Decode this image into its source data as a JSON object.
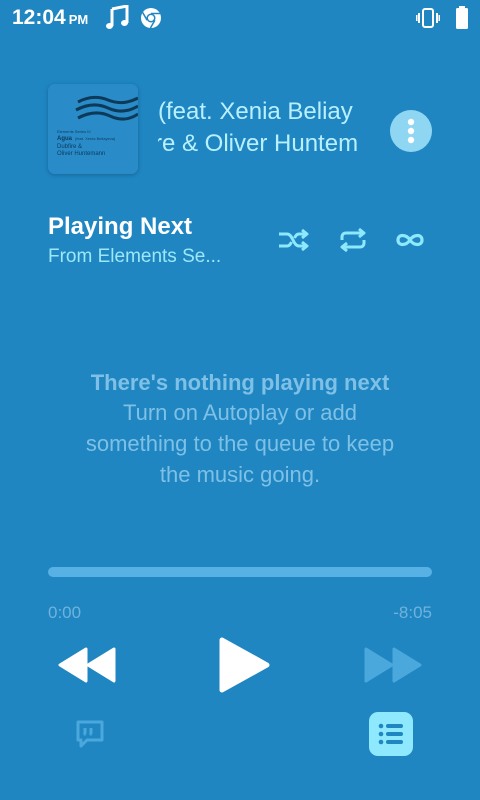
{
  "status_bar": {
    "time": "12:04",
    "ampm": "PM",
    "icons": [
      "music-note-icon",
      "chrome-icon",
      "vibrate-icon",
      "battery-icon"
    ]
  },
  "now_playing": {
    "album_art": {
      "series": "Elements Series III",
      "title": "Agua",
      "featuring": "(feat. Xenia Beliayeva)",
      "artist_line1": "Dubfire &",
      "artist_line2": "Oliver Huntemann"
    },
    "title_visible": "(feat. Xenia Beliay",
    "artist_visible": "re & Oliver Huntem"
  },
  "queue": {
    "title": "Playing Next",
    "source": "From Elements Se...",
    "modes": [
      "shuffle-icon",
      "repeat-icon",
      "infinity-icon"
    ]
  },
  "empty_state": {
    "title": "There's nothing playing next",
    "message_line1": "Turn on Autoplay or add",
    "message_line2": "something to the queue to keep",
    "message_line3": "the music going."
  },
  "playback": {
    "elapsed": "0:00",
    "remaining": "-8:05",
    "progress_fraction": 0
  },
  "controls": {
    "icons": [
      "rewind-icon",
      "play-icon",
      "fast-forward-icon",
      "lyrics-icon",
      "queue-list-icon"
    ]
  },
  "colors": {
    "background": "#1f86c2",
    "accent": "#8ee9ff",
    "muted_text": "#7ec0e6"
  }
}
